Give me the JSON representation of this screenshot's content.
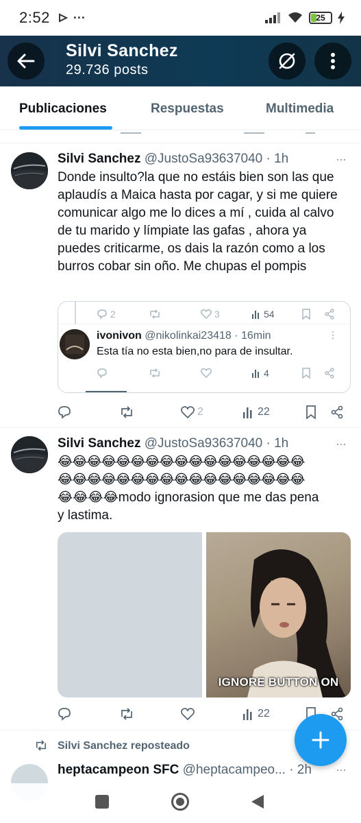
{
  "status_bar": {
    "time": "2:52",
    "battery": "25"
  },
  "header": {
    "name": "Silvi Sanchez",
    "posts": "29.736 posts"
  },
  "tabs": [
    {
      "label": "Publicaciones"
    },
    {
      "label": "Respuestas"
    },
    {
      "label": "Multimedia"
    }
  ],
  "tweet1": {
    "name": "Silvi Sanchez",
    "handle": "@JustoSa93637040 · 1h",
    "text": "Donde insulto?la que no estáis bien son las que aplaudís a Maica hasta por cagar, y si me quiere comunicar algo me lo dices a mí , cuida al calvo de tu marido y límpiate las gafas , ahora ya puedes criticarme, os dais la razón como a los burros cobar sin oño. Me chupas el pompis",
    "quote_top_actions": {
      "replies": "2",
      "likes": "3",
      "views": "54"
    },
    "quote": {
      "name": "ivonivon",
      "handle": "@nikolinkai23418 · 16min",
      "text": "Esta tía  no esta bien,no para de insultar.",
      "views": "4"
    },
    "actions": {
      "likes": "2",
      "views": "22"
    }
  },
  "tweet2": {
    "name": "Silvi Sanchez",
    "handle": "@JustoSa93637040 · 1h",
    "emoji_line1": "😂😂😂😂😂😂😂😂😂😂😂😂😂😂😂😂😂",
    "emoji_line2": "😂😂😂😂😂😂😂😂😂😂😂😂😂😂😂😂😂",
    "line3": "😂😂😂😂modo ignorasion que me das pena",
    "line4": "y lastima.",
    "gif_caption": "IGNORE BUTTON ON",
    "actions": {
      "views": "22"
    }
  },
  "repost": {
    "label": "Silvi Sanchez reposteado",
    "name": "heptacampeon SFC",
    "handle": "@heptacampeo... · 2h"
  },
  "colors": {
    "accent": "#1d9bf0",
    "header_bg": "#0e3a55"
  }
}
